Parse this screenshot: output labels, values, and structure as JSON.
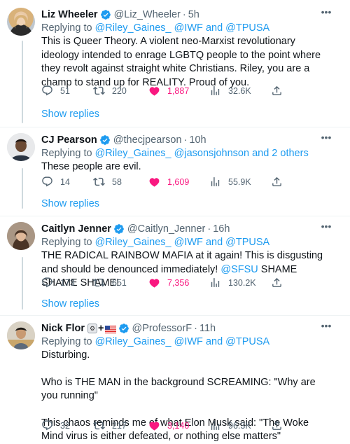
{
  "tweets": [
    {
      "name": "Liz Wheeler",
      "handle": "@Liz_Wheeler",
      "time": "5h",
      "replying_prefix": "Replying to",
      "replying_to": "@Riley_Gaines_ @IWF and @TPUSA",
      "body": "This is Queer Theory. A violent neo-Marxist revolutionary ideology intended to enrage LGBTQ people to the point where they revolt against straight white Christians. Riley, you are a champ to stand up for REALITY. Proud of you.",
      "replies": "51",
      "retweets": "220",
      "likes": "1,887",
      "views": "32.6K",
      "show_replies": "Show replies"
    },
    {
      "name": "CJ Pearson",
      "handle": "@thecjpearson",
      "time": "10h",
      "replying_prefix": "Replying to",
      "replying_to": "@Riley_Gaines_ @jasonsjohnson and 2 others",
      "body": "These people are evil.",
      "replies": "14",
      "retweets": "58",
      "likes": "1,609",
      "views": "55.9K",
      "show_replies": "Show replies"
    },
    {
      "name": "Caitlyn Jenner",
      "handle": "@Caitlyn_Jenner",
      "time": "16h",
      "replying_prefix": "Replying to",
      "replying_to": "@Riley_Gaines_ @IWF and @TPUSA",
      "body_pre": "THE RADICAL RAINBOW MAFIA at it again! This is disgusting and should be denounced immediately! ",
      "body_mention": "@SFSU",
      "body_post": " SHAME SHAME SHAME!",
      "replies": "173",
      "retweets": "651",
      "likes": "7,356",
      "views": "130.2K",
      "show_replies": "Show replies"
    },
    {
      "name": "Nick Flor",
      "name_suffix": "+",
      "handle": "@ProfessorF",
      "time": "11h",
      "replying_prefix": "Replying to",
      "replying_to": "@Riley_Gaines_ @IWF and @TPUSA",
      "body_p1": "Disturbing.",
      "body_p2": "Who is THE MAN in the background SCREAMING: \"Why are you running\"",
      "body_p3": "This chaos reminds me of what Elon Musk said: \"The Woke Mind virus is either defeated, or nothing else matters\"",
      "replies": "32",
      "retweets": "217",
      "likes": "3,140",
      "views": "96.3K"
    }
  ],
  "colors": {
    "link": "#1d9bf0",
    "like": "#f91880",
    "muted": "#536471",
    "verified": "#1d9bf0"
  },
  "icons": [
    "reply-icon",
    "retweet-icon",
    "heart-icon",
    "views-icon",
    "share-icon",
    "verified-icon",
    "more-icon"
  ]
}
